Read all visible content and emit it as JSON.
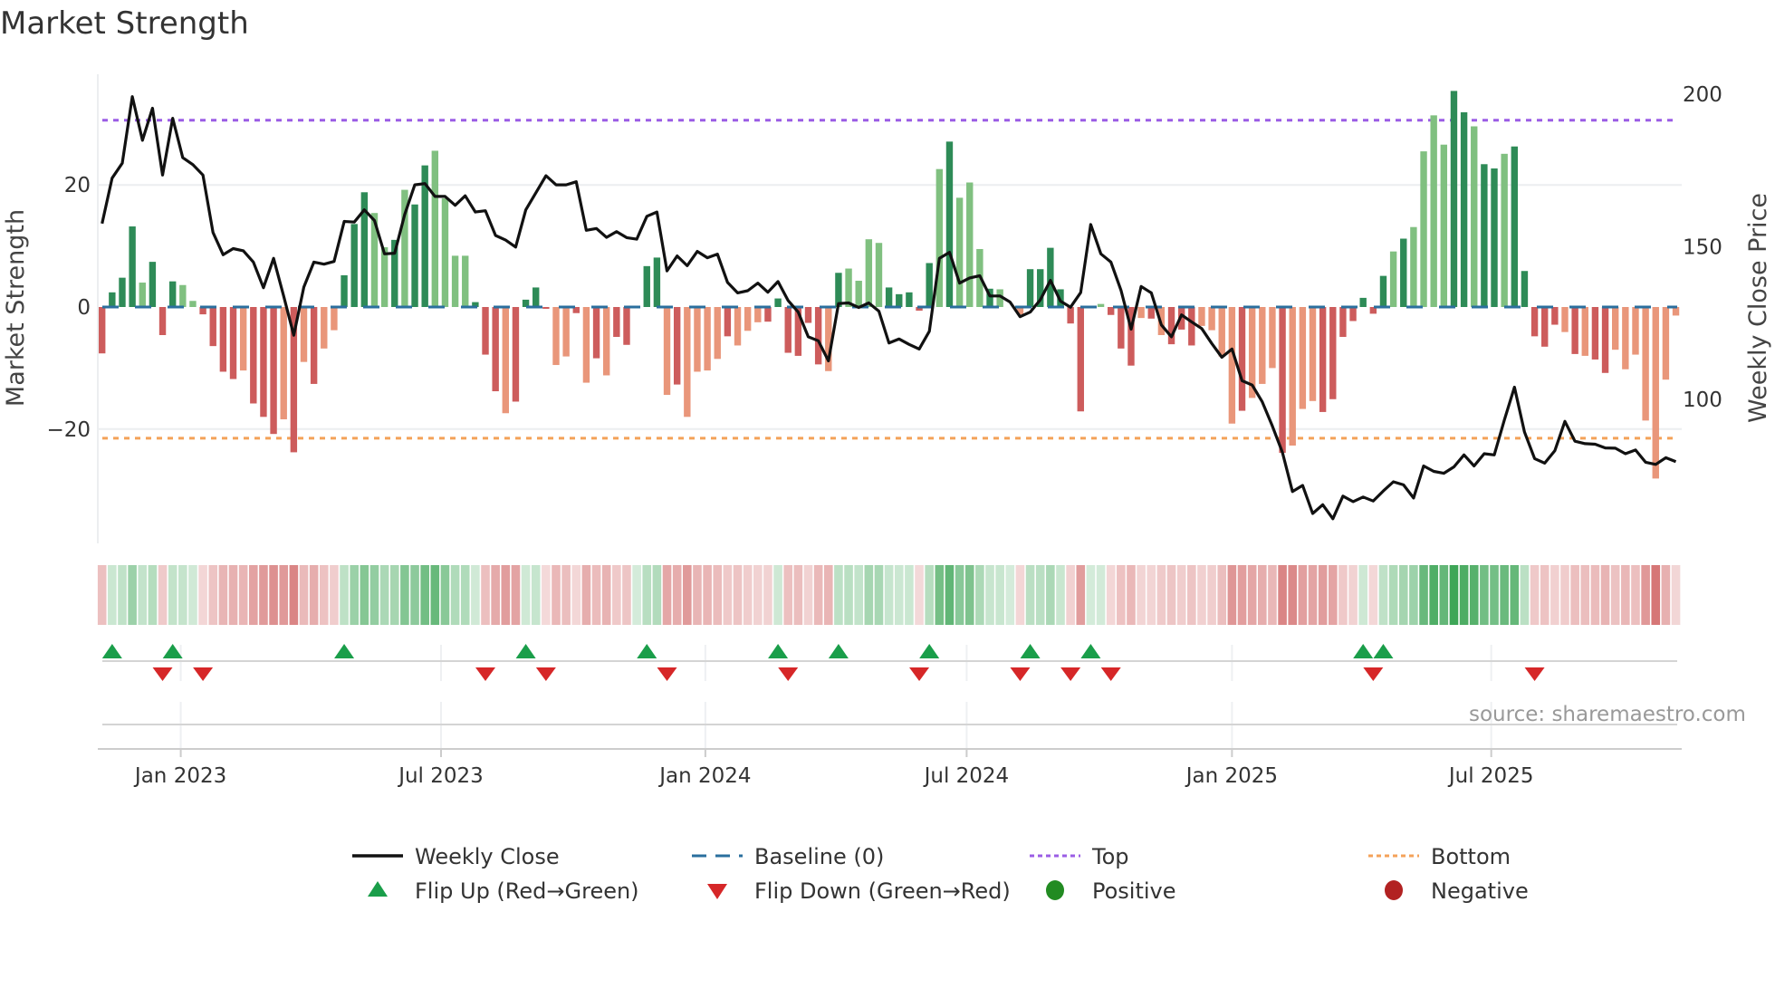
{
  "title": "Market Strength",
  "source": "source: sharemaestro.com",
  "colors": {
    "pos_dark": "#2e8b57",
    "pos_light": "#80c080",
    "neg_dark": "#cd5c5c",
    "neg_light": "#e9967a",
    "baseline": "#2a6f9e",
    "top": "#9b5de5",
    "bottom": "#f4a259",
    "flip_up": "#1a9e4a",
    "flip_down": "#d62728",
    "positive": "#228b22",
    "negative": "#b22222",
    "price": "#111111"
  },
  "legend": [
    {
      "key": "close",
      "label": "Weekly Close"
    },
    {
      "key": "baseline",
      "label": "Baseline (0)"
    },
    {
      "key": "top",
      "label": "Top"
    },
    {
      "key": "bottom",
      "label": "Bottom"
    },
    {
      "key": "flip_up",
      "label": "Flip Up (Red→Green)"
    },
    {
      "key": "flip_down",
      "label": "Flip Down (Green→Red)"
    },
    {
      "key": "positive",
      "label": "Positive"
    },
    {
      "key": "negative",
      "label": "Negative"
    }
  ],
  "chart_data": {
    "type": "bar",
    "title": "Market Strength",
    "ylabel": "Market Strength",
    "y2label": "Weekly Close Price",
    "ylim": [
      -38,
      38
    ],
    "y2lim": [
      52.6,
      206.7
    ],
    "yticks": [
      {
        "v": 20,
        "label": "20"
      },
      {
        "v": 0,
        "label": "0"
      },
      {
        "v": -20,
        "label": "−20"
      }
    ],
    "y2ticks": [
      {
        "v": 200,
        "label": "200"
      },
      {
        "v": 150,
        "label": "150"
      },
      {
        "v": 100,
        "label": "100"
      }
    ],
    "x_ticks": [
      {
        "label": "Jan 2023",
        "week": 7.8
      },
      {
        "label": "Jul 2023",
        "week": 33.6
      },
      {
        "label": "Jan 2024",
        "week": 59.8
      },
      {
        "label": "Jul 2024",
        "week": 85.7
      },
      {
        "label": "Jan 2025",
        "week": 112.0
      },
      {
        "label": "Jul 2025",
        "week": 137.7
      }
    ],
    "top_level": 30.6,
    "bottom_level": -21.5,
    "strength": [
      -7.6,
      2.4,
      4.8,
      13.2,
      4.0,
      7.4,
      -4.6,
      4.2,
      3.6,
      1.0,
      -1.2,
      -6.4,
      -10.6,
      -11.8,
      -10.4,
      -15.8,
      -18.0,
      -20.8,
      -18.4,
      -23.8,
      -9.0,
      -12.6,
      -6.8,
      -3.8,
      5.2,
      13.6,
      18.8,
      15.4,
      9.8,
      11.0,
      19.2,
      16.8,
      23.2,
      25.6,
      17.8,
      8.4,
      8.4,
      0.8,
      -7.8,
      -13.8,
      -17.4,
      -15.5,
      1.2,
      3.2,
      -0.3,
      -9.5,
      -8.1,
      -1.0,
      -12.4,
      -8.4,
      -11.2,
      -4.9,
      -6.2,
      0,
      6.7,
      8.1,
      -14.4,
      -12.7,
      -18.0,
      -10.6,
      -10.4,
      -8.5,
      -4.8,
      -6.3,
      -3.9,
      -2.5,
      -2.4,
      1.4,
      -7.5,
      -8.0,
      -2.6,
      -9.4,
      -10.5,
      5.6,
      6.3,
      4.3,
      11.1,
      10.5,
      3.2,
      2.1,
      2.4,
      -0.6,
      7.2,
      22.6,
      27.1,
      17.9,
      20.4,
      9.5,
      3.0,
      2.9,
      0,
      -1.2,
      6.2,
      6.2,
      9.7,
      2.9,
      -2.7,
      -17.1,
      0.2,
      0.5,
      -1.3,
      -6.8,
      -9.6,
      -1.8,
      -1.9,
      -4.6,
      -6.1,
      -3.7,
      -6.3,
      -3.1,
      -3.8,
      -8.1,
      -19.1,
      -17.0,
      -14.9,
      -12.6,
      -10.0,
      -23.9,
      -22.7,
      -16.7,
      -15.4,
      -17.2,
      -15.1,
      -4.9,
      -2.3,
      1.5,
      -1.1,
      5.1,
      9.1,
      11.2,
      13.1,
      25.5,
      31.4,
      26.6,
      35.4,
      31.9,
      29.6,
      23.4,
      22.7,
      25.1,
      26.3,
      5.9,
      -4.8,
      -6.5,
      -2.9,
      -4.1,
      -7.7,
      -8.0,
      -8.6,
      -10.8,
      -7.0,
      -10.2,
      -7.8,
      -18.6,
      -28.1,
      -11.9,
      -1.4
    ],
    "shade": "ddddldddllddddldddldldlldddlldlddlllldddlddddlldldldddddldlllldlllddddddldlllldddddldllldldldddddddldddldldddlllldllldllldddddddldllllddlddlddddd ldlddll",
    "weekly_close": [
      157.6,
      172.5,
      177.4,
      199.2,
      184.9,
      195.4,
      173.5,
      192.1,
      179.2,
      176.9,
      173.5,
      154.7,
      147.4,
      149.4,
      148.7,
      145.0,
      136.6,
      146.2,
      133.9,
      121.0,
      136.8,
      145.0,
      144.3,
      145.2,
      158.3,
      158.1,
      162.1,
      158.6,
      147.7,
      147.9,
      160.6,
      170.3,
      170.7,
      166.5,
      166.5,
      163.6,
      166.7,
      161.4,
      161.8,
      153.7,
      152.2,
      149.9,
      162.1,
      167.7,
      173.3,
      170.3,
      170.3,
      171.3,
      155.4,
      156.0,
      153.1,
      155.0,
      153.0,
      152.5,
      160.0,
      161.4,
      142.1,
      147.0,
      143.8,
      148.5,
      146.4,
      147.6,
      138.3,
      134.9,
      135.6,
      138.1,
      135.1,
      138.6,
      132.4,
      128.6,
      120.5,
      119.2,
      112.6,
      131.4,
      131.6,
      130.1,
      131.6,
      128.9,
      118.5,
      119.8,
      118.0,
      116.5,
      122.3,
      146.2,
      148.2,
      138.1,
      139.8,
      140.5,
      133.9,
      133.9,
      131.9,
      127.1,
      128.6,
      132.6,
      139.0,
      132.2,
      130.2,
      135.0,
      157.3,
      147.7,
      145.0,
      135.8,
      123.0,
      137.0,
      134.9,
      124.4,
      120.5,
      127.7,
      125.4,
      123.2,
      118.3,
      113.8,
      116.5,
      106.1,
      104.7,
      99.2,
      91.3,
      82.6,
      69.8,
      71.8,
      62.6,
      65.5,
      60.9,
      68.3,
      66.5,
      68.0,
      66.7,
      70.0,
      73.0,
      72.0,
      67.7,
      78.2,
      76.4,
      75.8,
      77.9,
      81.8,
      78.2,
      82.2,
      81.8,
      93.3,
      104.0,
      89.3,
      80.6,
      79.1,
      83.2,
      92.8,
      86.3,
      85.5,
      85.3,
      84.1,
      84.0,
      82.2,
      83.4,
      79.4,
      78.7,
      80.9,
      79.6
    ]
  }
}
